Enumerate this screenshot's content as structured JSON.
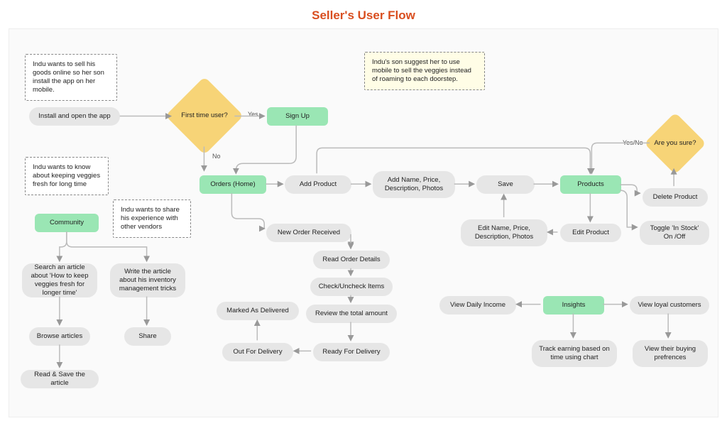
{
  "title": "Seller's User Flow",
  "notes": {
    "install": "Indu wants to sell his goods online so her son install the app on her mobile.",
    "son_suggest": "Indu's son suggest her to use mobile to sell the veggies instead of roaming to each doorstep.",
    "fresh": "Indu wants to know about keeping veggies fresh for long time",
    "share_exp": "Indu wants to share his experience with other vendors"
  },
  "nodes": {
    "install_open": "Install and open the app",
    "first_time": "First time user?",
    "sign_up": "Sign Up",
    "orders_home": "Orders (Home)",
    "add_product": "Add Product",
    "add_details": "Add Name, Price, Description, Photos",
    "save": "Save",
    "products": "Products",
    "delete_product": "Delete Product",
    "are_you_sure": "Are you sure?",
    "toggle_stock": "Toggle 'In Stock' On /Off",
    "edit_product": "Edit Product",
    "edit_details": "Edit Name, Price, Description, Photos",
    "new_order": "New Order Received",
    "read_order": "Read Order Details",
    "check_items": "Check/Uncheck Items",
    "review_amount": "Review the total amount",
    "ready_delivery": "Ready For Delivery",
    "out_delivery": "Out For Delivery",
    "marked_delivered": "Marked As Delivered",
    "community": "Community",
    "search_article": "Search an article about 'How to keep veggies fresh for longer time'",
    "write_article": "Write the article about his inventory management tricks",
    "browse_articles": "Browse articles",
    "share": "Share",
    "read_save": "Read & Save the article",
    "insights": "Insights",
    "view_income": "View Daily Income",
    "track_earning": "Track earning based on time using chart",
    "view_loyal": "View loyal customers",
    "view_pref": "View their buying prefrences"
  },
  "edges": {
    "yes": "Yes",
    "no": "No",
    "yes_no": "Yes/No"
  }
}
